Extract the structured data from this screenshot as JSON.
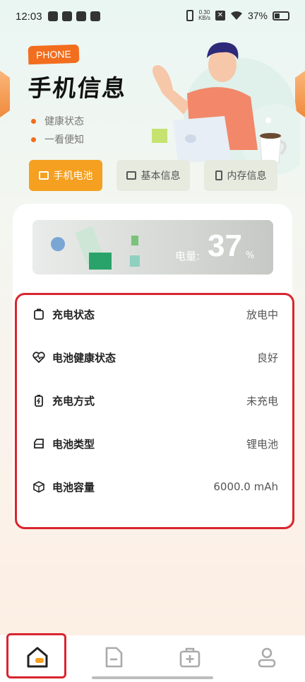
{
  "status_bar": {
    "time": "12:03",
    "net_speed": "0.30",
    "net_unit": "KB/s",
    "battery_pct": "37%"
  },
  "header": {
    "tag": "PHONE",
    "title": "手机信息",
    "bullets": [
      "健康状态",
      "一看便知"
    ]
  },
  "tabs": [
    {
      "label": "手机电池",
      "icon": "battery-icon",
      "active": true
    },
    {
      "label": "基本信息",
      "icon": "chat-icon",
      "active": false
    },
    {
      "label": "内存信息",
      "icon": "phone-icon",
      "active": false
    }
  ],
  "battery_level": {
    "label": "电量:",
    "value": "37",
    "unit": "%"
  },
  "info_rows": [
    {
      "label": "充电状态",
      "value": "放电中",
      "icon": "battery-outline-icon"
    },
    {
      "label": "电池健康状态",
      "value": "良好",
      "icon": "heartbeat-icon"
    },
    {
      "label": "充电方式",
      "value": "未充电",
      "icon": "charging-icon"
    },
    {
      "label": "电池类型",
      "value": "锂电池",
      "icon": "sd-card-icon"
    },
    {
      "label": "电池容量",
      "value": "6000.0 mAh",
      "icon": "cube-icon"
    }
  ],
  "bottom_nav": [
    {
      "name": "home",
      "icon": "home-icon",
      "active": true
    },
    {
      "name": "document",
      "icon": "document-minus-icon",
      "active": false
    },
    {
      "name": "toolbox",
      "icon": "medical-box-icon",
      "active": false
    },
    {
      "name": "profile",
      "icon": "user-icon",
      "active": false
    }
  ],
  "colors": {
    "accent": "#f5a020",
    "tag": "#f26d1d",
    "highlight_border": "#d9252f"
  }
}
